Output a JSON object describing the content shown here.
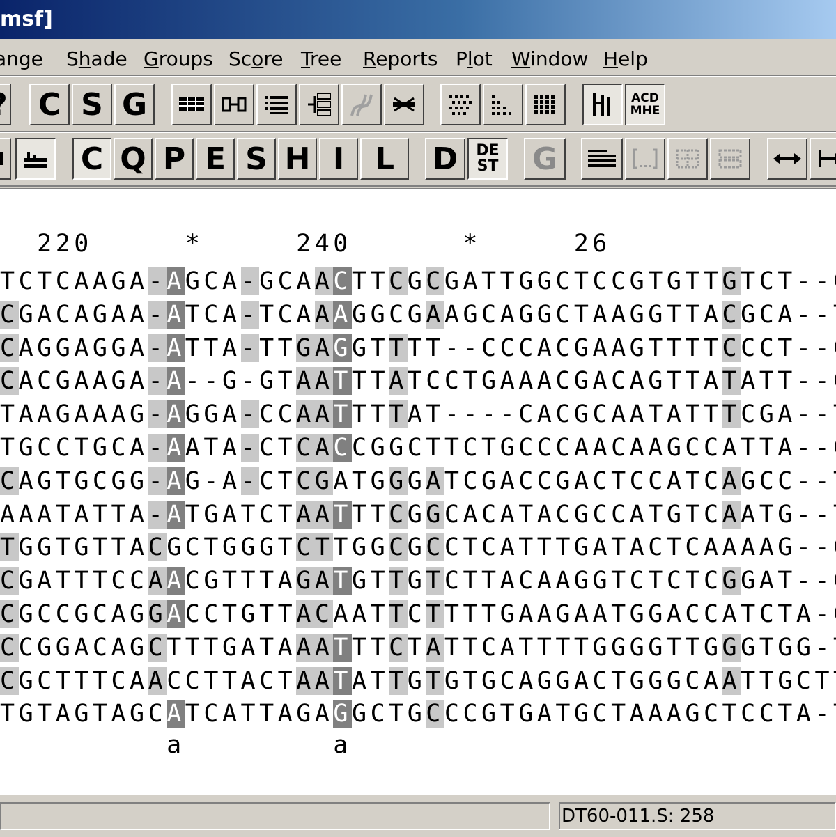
{
  "window": {
    "title": "msf]"
  },
  "menu": {
    "items": [
      {
        "label": "ange",
        "underline": ""
      },
      {
        "label": "Shade",
        "underline": "h"
      },
      {
        "label": "Groups",
        "underline": "G"
      },
      {
        "label": "Score",
        "underline": "o"
      },
      {
        "label": "Tree",
        "underline": "T"
      },
      {
        "label": "Reports",
        "underline": "R"
      },
      {
        "label": "Plot",
        "underline": "l"
      },
      {
        "label": "Window",
        "underline": "W"
      },
      {
        "label": "Help",
        "underline": "H"
      }
    ]
  },
  "toolbar1": {
    "help_label": "?",
    "c_label": "C",
    "s_label": "S",
    "g_label": "G",
    "abc_label_top": "ACD",
    "abc_label_bottom": "MHE"
  },
  "toolbar2": {
    "letters": [
      "C",
      "Q",
      "P",
      "E",
      "S",
      "H",
      "I",
      "L"
    ],
    "d_label": "D",
    "dest_top": "DE",
    "dest_bottom": "ST",
    "g_label": "G"
  },
  "alignment": {
    "ruler": "  220     *     240      *     26",
    "rows": [
      "TCTCAAGA-AGCA-GCAACTTCGCGATTGGCTCCGTGTTGTCT--C",
      "CGACAGAA-ATCA-TCAAAGGCGAAGCAGGCTAAGGTTACGCA--T",
      "CAGGAGGA-ATTA-TTGAGGTTTT--CCCACGAAGTTTTCCCT--C",
      "CACGAAGA-A--G-GTAATTTATCCTGAAACGACAGTTATATT--C",
      "TAAGAAAG-AGGA-CCAATTTTAT----CACGCAATATTTCGA--T",
      "TGCCTGCA-AATA-CTCACCGGCTTCTGCCCAACAAGCCATTA--C",
      "CAGTGCGG-AG-A-CTCGATGGGATCGACCGACTCCATCAGCC--T",
      "AAATATTA-ATGATCTAATTTCGGCACATACGCCATGTCAATG--T",
      "TGGTGTTACGCTGGGTCTTGGCGCCTCATTTGATACTCAAAAG--C",
      "CGATTTCCAACGTTTAGATGTTGTCTTACAAGGTCTCTCGGAT--C",
      "CGCCGCAGGACCTGTTACAATTCTTTTGAAGAATGGACCATCTA-C",
      "CCGGACAGCTTTGATAAATTTCTATTCATTTTGGGGTTGGGTGG-T",
      "CGCTTTCAACCTTACTAATATTGTGTGCAGGACTGGGCAATTGCTT",
      "TGTAGTAGCATCATTAGAGGCTGCCCGTGATGCTAAAGCTCCTA-T"
    ],
    "consensus": "         a        a"
  },
  "status": {
    "text": "DT60-011.S: 258"
  },
  "colors": {
    "shade_light": "#c8c8c8",
    "shade_dark": "#808080",
    "title_start": "#0a246a",
    "title_end": "#a6caf0"
  }
}
